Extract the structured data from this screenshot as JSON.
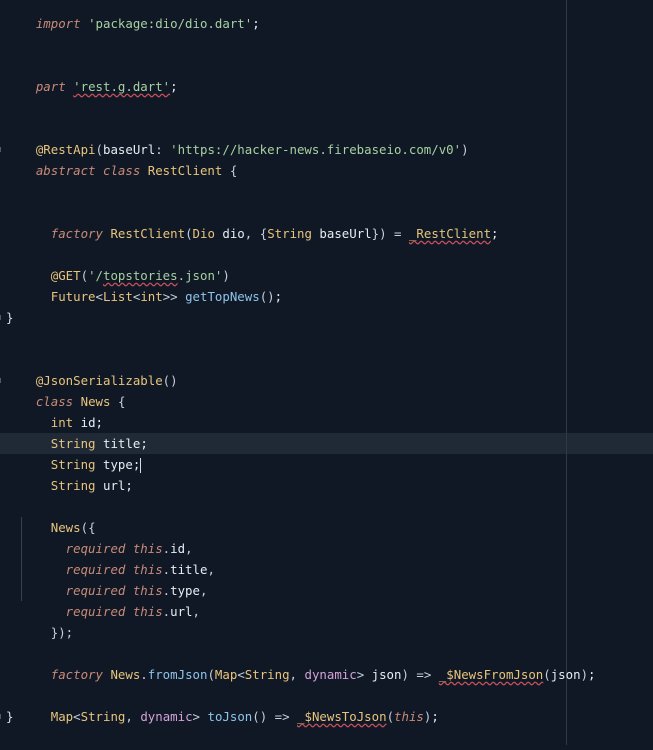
{
  "editor": {
    "lines": {
      "import": "import 'package:dio/dio.dart';",
      "part": "part 'rest.g.dart';",
      "restapi": "@RestApi(baseUrl: 'https://hacker-news.firebaseio.com/v0')",
      "abstract": "abstract class RestClient {",
      "factory": "  factory RestClient(Dio dio, {String baseUrl}) = _RestClient;",
      "get": "  @GET('/topstories.json')",
      "future": "  Future<List<int>> getTopNews();",
      "close1": "}",
      "json": "@JsonSerializable()",
      "class": "class News {",
      "id": "  int id;",
      "title": "  String title;",
      "type": "  String type;",
      "url": "  String url;",
      "ctor": "  News({",
      "req_id": "    required this.id,",
      "req_title": "    required this.title,",
      "req_type": "    required this.type,",
      "req_url": "    required this.url,",
      "ctor_end": "  });",
      "fromjson": "  factory News.fromJson(Map<String, dynamic> json) => _$NewsFromJson(json);",
      "tojson": "  Map<String, dynamic> toJson() => _$NewsToJson(this);",
      "close2": "}"
    }
  }
}
